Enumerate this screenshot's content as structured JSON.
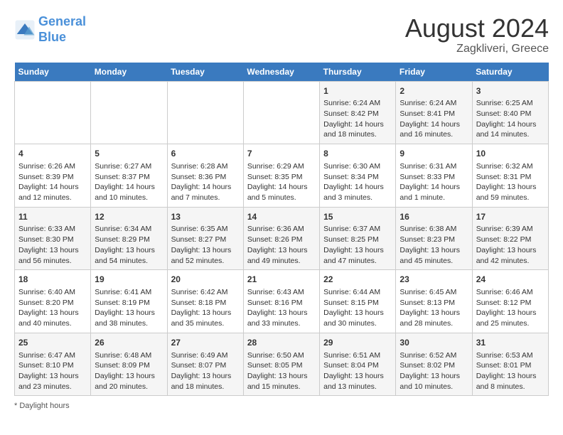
{
  "logo": {
    "line1": "General",
    "line2": "Blue"
  },
  "title": "August 2024",
  "subtitle": "Zagkliveri, Greece",
  "days_of_week": [
    "Sunday",
    "Monday",
    "Tuesday",
    "Wednesday",
    "Thursday",
    "Friday",
    "Saturday"
  ],
  "footnote": "Daylight hours",
  "weeks": [
    [
      {
        "num": "",
        "info": ""
      },
      {
        "num": "",
        "info": ""
      },
      {
        "num": "",
        "info": ""
      },
      {
        "num": "",
        "info": ""
      },
      {
        "num": "1",
        "info": "Sunrise: 6:24 AM\nSunset: 8:42 PM\nDaylight: 14 hours\nand 18 minutes."
      },
      {
        "num": "2",
        "info": "Sunrise: 6:24 AM\nSunset: 8:41 PM\nDaylight: 14 hours\nand 16 minutes."
      },
      {
        "num": "3",
        "info": "Sunrise: 6:25 AM\nSunset: 8:40 PM\nDaylight: 14 hours\nand 14 minutes."
      }
    ],
    [
      {
        "num": "4",
        "info": "Sunrise: 6:26 AM\nSunset: 8:39 PM\nDaylight: 14 hours\nand 12 minutes."
      },
      {
        "num": "5",
        "info": "Sunrise: 6:27 AM\nSunset: 8:37 PM\nDaylight: 14 hours\nand 10 minutes."
      },
      {
        "num": "6",
        "info": "Sunrise: 6:28 AM\nSunset: 8:36 PM\nDaylight: 14 hours\nand 7 minutes."
      },
      {
        "num": "7",
        "info": "Sunrise: 6:29 AM\nSunset: 8:35 PM\nDaylight: 14 hours\nand 5 minutes."
      },
      {
        "num": "8",
        "info": "Sunrise: 6:30 AM\nSunset: 8:34 PM\nDaylight: 14 hours\nand 3 minutes."
      },
      {
        "num": "9",
        "info": "Sunrise: 6:31 AM\nSunset: 8:33 PM\nDaylight: 14 hours\nand 1 minute."
      },
      {
        "num": "10",
        "info": "Sunrise: 6:32 AM\nSunset: 8:31 PM\nDaylight: 13 hours\nand 59 minutes."
      }
    ],
    [
      {
        "num": "11",
        "info": "Sunrise: 6:33 AM\nSunset: 8:30 PM\nDaylight: 13 hours\nand 56 minutes."
      },
      {
        "num": "12",
        "info": "Sunrise: 6:34 AM\nSunset: 8:29 PM\nDaylight: 13 hours\nand 54 minutes."
      },
      {
        "num": "13",
        "info": "Sunrise: 6:35 AM\nSunset: 8:27 PM\nDaylight: 13 hours\nand 52 minutes."
      },
      {
        "num": "14",
        "info": "Sunrise: 6:36 AM\nSunset: 8:26 PM\nDaylight: 13 hours\nand 49 minutes."
      },
      {
        "num": "15",
        "info": "Sunrise: 6:37 AM\nSunset: 8:25 PM\nDaylight: 13 hours\nand 47 minutes."
      },
      {
        "num": "16",
        "info": "Sunrise: 6:38 AM\nSunset: 8:23 PM\nDaylight: 13 hours\nand 45 minutes."
      },
      {
        "num": "17",
        "info": "Sunrise: 6:39 AM\nSunset: 8:22 PM\nDaylight: 13 hours\nand 42 minutes."
      }
    ],
    [
      {
        "num": "18",
        "info": "Sunrise: 6:40 AM\nSunset: 8:20 PM\nDaylight: 13 hours\nand 40 minutes."
      },
      {
        "num": "19",
        "info": "Sunrise: 6:41 AM\nSunset: 8:19 PM\nDaylight: 13 hours\nand 38 minutes."
      },
      {
        "num": "20",
        "info": "Sunrise: 6:42 AM\nSunset: 8:18 PM\nDaylight: 13 hours\nand 35 minutes."
      },
      {
        "num": "21",
        "info": "Sunrise: 6:43 AM\nSunset: 8:16 PM\nDaylight: 13 hours\nand 33 minutes."
      },
      {
        "num": "22",
        "info": "Sunrise: 6:44 AM\nSunset: 8:15 PM\nDaylight: 13 hours\nand 30 minutes."
      },
      {
        "num": "23",
        "info": "Sunrise: 6:45 AM\nSunset: 8:13 PM\nDaylight: 13 hours\nand 28 minutes."
      },
      {
        "num": "24",
        "info": "Sunrise: 6:46 AM\nSunset: 8:12 PM\nDaylight: 13 hours\nand 25 minutes."
      }
    ],
    [
      {
        "num": "25",
        "info": "Sunrise: 6:47 AM\nSunset: 8:10 PM\nDaylight: 13 hours\nand 23 minutes."
      },
      {
        "num": "26",
        "info": "Sunrise: 6:48 AM\nSunset: 8:09 PM\nDaylight: 13 hours\nand 20 minutes."
      },
      {
        "num": "27",
        "info": "Sunrise: 6:49 AM\nSunset: 8:07 PM\nDaylight: 13 hours\nand 18 minutes."
      },
      {
        "num": "28",
        "info": "Sunrise: 6:50 AM\nSunset: 8:05 PM\nDaylight: 13 hours\nand 15 minutes."
      },
      {
        "num": "29",
        "info": "Sunrise: 6:51 AM\nSunset: 8:04 PM\nDaylight: 13 hours\nand 13 minutes."
      },
      {
        "num": "30",
        "info": "Sunrise: 6:52 AM\nSunset: 8:02 PM\nDaylight: 13 hours\nand 10 minutes."
      },
      {
        "num": "31",
        "info": "Sunrise: 6:53 AM\nSunset: 8:01 PM\nDaylight: 13 hours\nand 8 minutes."
      }
    ]
  ]
}
